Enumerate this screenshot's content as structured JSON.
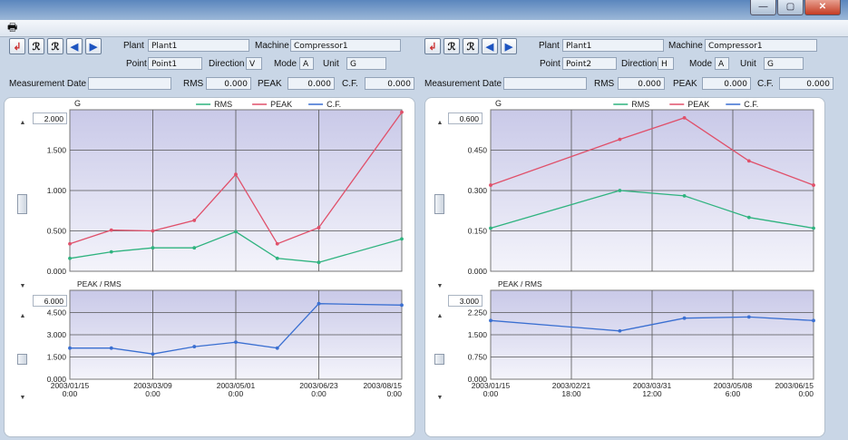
{
  "window": {
    "buttons": {
      "minimize": "—",
      "maximize": "▢",
      "close": "✕"
    }
  },
  "toolbar": {
    "print_icon": "printer-icon"
  },
  "icons": {
    "pin": "↲",
    "zoom_in": "ℛ",
    "zoom_out": "ℛ",
    "prev": "◀",
    "next": "▶"
  },
  "colors": {
    "rms": "#2fb37f",
    "peak": "#e0506a",
    "cf": "#3a6fd1",
    "plot_bg": "#dcdcef"
  },
  "panels": [
    {
      "plant_label": "Plant",
      "plant": "Plant1",
      "machine_label": "Machine",
      "machine": "Compressor1",
      "point_label": "Point",
      "point": "Point1",
      "direction_label": "Direction",
      "direction": "V",
      "mode_label": "Mode",
      "mode": "A",
      "unit_label": "Unit",
      "unit": "G",
      "measurement_date_label": "Measurement Date",
      "measurement_date": "",
      "rms_label": "RMS",
      "rms": "0.000",
      "peak_label": "PEAK",
      "peak": "0.000",
      "cf_label": "C.F.",
      "cf": "0.000",
      "top_ylim_box": "2.000",
      "bottom_ylim_box": "6.000",
      "unit_axis": "G",
      "ratio_axis": "PEAK / RMS",
      "legend": [
        "RMS",
        "PEAK",
        "C.F."
      ],
      "x_ticks": [
        {
          "pos": 0.0,
          "l1": "2003/01/15",
          "l2": "0:00"
        },
        {
          "pos": 0.25,
          "l1": "2003/03/09",
          "l2": "0:00"
        },
        {
          "pos": 0.5,
          "l1": "2003/05/01",
          "l2": "0:00"
        },
        {
          "pos": 0.75,
          "l1": "2003/06/23",
          "l2": "0:00"
        },
        {
          "pos": 1.0,
          "l1": "2003/08/15",
          "l2": "0:00"
        }
      ]
    },
    {
      "plant_label": "Plant",
      "plant": "Plant1",
      "machine_label": "Machine",
      "machine": "Compressor1",
      "point_label": "Point",
      "point": "Point2",
      "direction_label": "Direction",
      "direction": "H",
      "mode_label": "Mode",
      "mode": "A",
      "unit_label": "Unit",
      "unit": "G",
      "measurement_date_label": "Measurement Date",
      "measurement_date": "",
      "rms_label": "RMS",
      "rms": "0.000",
      "peak_label": "PEAK",
      "peak": "0.000",
      "cf_label": "C.F.",
      "cf": "0.000",
      "top_ylim_box": "0.600",
      "bottom_ylim_box": "3.000",
      "unit_axis": "G",
      "ratio_axis": "PEAK / RMS",
      "legend": [
        "RMS",
        "PEAK",
        "C.F."
      ],
      "x_ticks": [
        {
          "pos": 0.0,
          "l1": "2003/01/15",
          "l2": "0:00"
        },
        {
          "pos": 0.25,
          "l1": "2003/02/21",
          "l2": "18:00"
        },
        {
          "pos": 0.5,
          "l1": "2003/03/31",
          "l2": "12:00"
        },
        {
          "pos": 0.75,
          "l1": "2003/05/08",
          "l2": "6:00"
        },
        {
          "pos": 1.0,
          "l1": "2003/06/15",
          "l2": "0:00"
        }
      ]
    }
  ],
  "chart_data": [
    {
      "type": "line",
      "x": [
        0.0,
        0.125,
        0.25,
        0.375,
        0.5,
        0.625,
        0.75,
        0.875,
        1.0
      ],
      "ylim": [
        0,
        2.0
      ],
      "yticks": [
        "0.000",
        "0.500",
        "1.000",
        "1.500",
        "2.000"
      ],
      "series": [
        {
          "name": "RMS",
          "values": [
            0.16,
            0.24,
            0.29,
            0.29,
            0.49,
            0.16,
            0.11,
            0.4
          ]
        },
        {
          "name": "PEAK",
          "values": [
            0.34,
            0.51,
            0.5,
            0.63,
            1.2,
            0.34,
            0.54,
            1.97
          ]
        }
      ],
      "x_series": [
        0.0,
        0.125,
        0.25,
        0.375,
        0.5,
        0.625,
        0.75,
        1.0
      ]
    },
    {
      "type": "line",
      "ylim": [
        0,
        6.0
      ],
      "yticks": [
        "0.000",
        "1.500",
        "3.000",
        "4.500",
        "6.000"
      ],
      "series": [
        {
          "name": "C.F.",
          "values": [
            2.1,
            2.1,
            1.7,
            2.2,
            2.5,
            2.1,
            5.1,
            5.0
          ]
        }
      ],
      "x_series": [
        0.0,
        0.125,
        0.25,
        0.375,
        0.5,
        0.625,
        0.75,
        1.0
      ]
    },
    {
      "type": "line",
      "ylim": [
        0,
        0.6
      ],
      "yticks": [
        "0.000",
        "0.150",
        "0.300",
        "0.450",
        "0.600"
      ],
      "series": [
        {
          "name": "RMS",
          "values": [
            0.16,
            0.3,
            0.28,
            0.2,
            0.16
          ]
        },
        {
          "name": "PEAK",
          "values": [
            0.32,
            0.49,
            0.57,
            0.41,
            0.32
          ]
        }
      ],
      "x_series": [
        0.0,
        0.4,
        0.6,
        0.8,
        1.0
      ]
    },
    {
      "type": "line",
      "ylim": [
        0,
        3.0
      ],
      "yticks": [
        "0.000",
        "0.750",
        "1.500",
        "2.250",
        "3.000"
      ],
      "series": [
        {
          "name": "C.F.",
          "values": [
            1.98,
            1.63,
            2.06,
            2.1,
            1.98
          ]
        }
      ],
      "x_series": [
        0.0,
        0.4,
        0.6,
        0.8,
        1.0
      ]
    }
  ]
}
